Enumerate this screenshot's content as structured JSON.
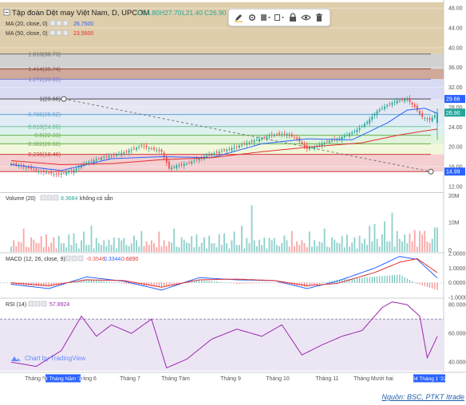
{
  "main_legend": {
    "title": "Tập đoàn Dệt may Việt Nam, D, UPCOM",
    "ohlc": [
      {
        "label": "O",
        "value": "24.80"
      },
      {
        "label": "H",
        "value": "27.70"
      },
      {
        "label": "L",
        "value": "21.40"
      },
      {
        "label": "C",
        "value": "26.90"
      }
    ],
    "ma20": {
      "label": "MA (20, close, 0)",
      "value": "26.7500",
      "color": "#2962ff"
    },
    "ma50": {
      "label": "MA (50, close, 0)",
      "value": "23.5600",
      "color": "#e03030"
    }
  },
  "fib_labels": [
    "1.618(38.73)",
    "1.414(35.74)",
    "1.272(33.65)",
    "1(29.66)",
    "0.786(26.52)",
    "0.618(24.06)",
    "0.5(22.33)",
    "0.382(20.60)",
    "0.236(18.46)"
  ],
  "price_axis": {
    "ticks": [
      "48.00",
      "44.00",
      "40.00",
      "36.00",
      "32.00",
      "28.00",
      "24.00",
      "20.00",
      "16.00",
      "12.00"
    ],
    "badges": [
      {
        "text": "29.66",
        "color": "#2962ff"
      },
      {
        "text": "26.90",
        "color": "#26a69a"
      },
      {
        "text": "14.99",
        "color": "#2962ff"
      }
    ]
  },
  "volume_legend": {
    "label": "Volume (20)",
    "value": "8.3684",
    "note": "không có sẵn"
  },
  "volume_axis": {
    "ticks": [
      "20M",
      "10M",
      "0"
    ]
  },
  "macd_legend": {
    "label": "MACD (12, 26, close, 9)",
    "values": [
      "-0.3546",
      "0.3344",
      "0.6890"
    ]
  },
  "macd_axis": {
    "ticks": [
      "2.0000",
      "1.0000",
      "0.0000",
      "-1.0000"
    ]
  },
  "rsi_legend": {
    "label": "RSI (14)",
    "value": "57.8924"
  },
  "rsi_axis": {
    "ticks": [
      "80.0000",
      "60.0000",
      "40.0000"
    ]
  },
  "time_axis": {
    "labels": [
      "Tháng 5",
      "Tháng 6",
      "Tháng 7",
      "Tháng Tám",
      "Tháng 9",
      "Tháng 10",
      "Tháng 11",
      "Tháng Mười hai"
    ],
    "start_badge": "18 Tháng Năm '21",
    "end_badge": "04 Tháng 1 '22"
  },
  "watermark": "Chart by TradingView",
  "source": "Nguồn: BSC, PTKT Itrade",
  "toolbar": [
    "pencil-icon",
    "gear-icon",
    "color-fill-icon",
    "rect-style-icon",
    "lock-icon",
    "eye-icon",
    "trash-icon"
  ],
  "chart_data": [
    {
      "type": "candlestick",
      "title": "Tập đoàn Dệt may Việt Nam, D, UPCOM",
      "ylim": [
        11,
        49
      ],
      "grid": true,
      "x_range": [
        "2021-05-18",
        "2022-01-04"
      ],
      "x_month_labels": [
        "Tháng 5",
        "Tháng 6",
        "Tháng 7",
        "Tháng Tám",
        "Tháng 9",
        "Tháng 10",
        "Tháng 11",
        "Tháng Mười hai"
      ],
      "close_path": [
        [
          0,
          16.6
        ],
        [
          6,
          15.8
        ],
        [
          12,
          15.0
        ],
        [
          18,
          14.4
        ],
        [
          24,
          15.0
        ],
        [
          30,
          16.8
        ],
        [
          36,
          17.8
        ],
        [
          42,
          18.4
        ],
        [
          48,
          19.4
        ],
        [
          52,
          20.2
        ],
        [
          56,
          19.6
        ],
        [
          60,
          19.0
        ],
        [
          63,
          15.6
        ],
        [
          66,
          16.2
        ],
        [
          70,
          16.6
        ],
        [
          75,
          17.6
        ],
        [
          80,
          18.6
        ],
        [
          86,
          19.4
        ],
        [
          92,
          20.4
        ],
        [
          98,
          21.4
        ],
        [
          104,
          22.4
        ],
        [
          110,
          22.6
        ],
        [
          114,
          21.6
        ],
        [
          118,
          19.6
        ],
        [
          122,
          20.2
        ],
        [
          126,
          21.0
        ],
        [
          130,
          21.6
        ],
        [
          134,
          22.4
        ],
        [
          138,
          23.4
        ],
        [
          142,
          25.0
        ],
        [
          146,
          27.2
        ],
        [
          150,
          28.4
        ],
        [
          154,
          29.3
        ],
        [
          158,
          29.6
        ],
        [
          161,
          28.0
        ],
        [
          164,
          26.0
        ],
        [
          167,
          25.4
        ],
        [
          170,
          26.9
        ]
      ],
      "series": [
        {
          "name": "MA (20, close, 0)",
          "color": "#2962ff",
          "points": [
            [
              0,
              16.4
            ],
            [
              20,
              15.2
            ],
            [
              40,
              17.6
            ],
            [
              60,
              18.0
            ],
            [
              80,
              17.8
            ],
            [
              100,
              20.6
            ],
            [
              118,
              21.6
            ],
            [
              136,
              21.4
            ],
            [
              150,
              24.8
            ],
            [
              158,
              27.4
            ],
            [
              165,
              27.8
            ],
            [
              170,
              26.75
            ]
          ]
        },
        {
          "name": "MA (50, close, 0)",
          "color": "#e03030",
          "points": [
            [
              0,
              17.2
            ],
            [
              20,
              16.4
            ],
            [
              40,
              16.6
            ],
            [
              60,
              17.4
            ],
            [
              80,
              17.8
            ],
            [
              100,
              19.0
            ],
            [
              120,
              20.0
            ],
            [
              140,
              20.8
            ],
            [
              155,
              22.4
            ],
            [
              165,
              23.2
            ],
            [
              170,
              23.56
            ]
          ]
        }
      ],
      "fibonacci_levels": [
        {
          "ratio": 1.618,
          "price": 38.73
        },
        {
          "ratio": 1.414,
          "price": 35.74
        },
        {
          "ratio": 1.272,
          "price": 33.65
        },
        {
          "ratio": 1,
          "price": 29.66
        },
        {
          "ratio": 0.786,
          "price": 26.52
        },
        {
          "ratio": 0.618,
          "price": 24.06
        },
        {
          "ratio": 0.5,
          "price": 22.33
        },
        {
          "ratio": 0.382,
          "price": 20.6
        },
        {
          "ratio": 0.236,
          "price": 18.46
        }
      ],
      "trendline": {
        "from_price": 29.66,
        "to_price": 14.99
      },
      "last": {
        "O": 24.8,
        "H": 27.7,
        "L": 21.4,
        "C": 26.9
      }
    },
    {
      "type": "bar",
      "name": "Volume (20)",
      "ylim": [
        0,
        20
      ],
      "unit": "M",
      "value": 8.3684
    },
    {
      "type": "line",
      "name": "MACD (12, 26, close, 9)",
      "ylim": [
        -1,
        2
      ],
      "values": {
        "histogram": -0.3546,
        "macd": 0.3344,
        "signal": 0.689
      },
      "macd_path": [
        [
          0,
          -0.1
        ],
        [
          15,
          -0.4
        ],
        [
          30,
          0.4
        ],
        [
          45,
          0.1
        ],
        [
          60,
          -0.5
        ],
        [
          75,
          0.35
        ],
        [
          90,
          0.2
        ],
        [
          105,
          0.15
        ],
        [
          118,
          -0.4
        ],
        [
          130,
          0.1
        ],
        [
          145,
          1.0
        ],
        [
          155,
          1.8
        ],
        [
          162,
          1.6
        ],
        [
          170,
          0.33
        ]
      ],
      "signal_path": [
        [
          0,
          0.0
        ],
        [
          15,
          -0.2
        ],
        [
          30,
          0.2
        ],
        [
          45,
          0.15
        ],
        [
          60,
          -0.3
        ],
        [
          75,
          0.2
        ],
        [
          90,
          0.25
        ],
        [
          105,
          0.15
        ],
        [
          118,
          -0.2
        ],
        [
          130,
          -0.05
        ],
        [
          145,
          0.7
        ],
        [
          155,
          1.4
        ],
        [
          162,
          1.65
        ],
        [
          170,
          0.69
        ]
      ]
    },
    {
      "type": "line",
      "name": "RSI (14)",
      "ylim": [
        34,
        84
      ],
      "value": 57.8924,
      "bands": [
        30,
        70
      ],
      "path": [
        [
          0,
          40
        ],
        [
          10,
          37
        ],
        [
          20,
          48
        ],
        [
          28,
          72
        ],
        [
          34,
          58
        ],
        [
          40,
          66
        ],
        [
          48,
          60
        ],
        [
          56,
          70
        ],
        [
          62,
          36
        ],
        [
          70,
          42
        ],
        [
          80,
          56
        ],
        [
          90,
          63
        ],
        [
          100,
          58
        ],
        [
          108,
          66
        ],
        [
          116,
          45
        ],
        [
          124,
          52
        ],
        [
          132,
          58
        ],
        [
          140,
          62
        ],
        [
          148,
          78
        ],
        [
          152,
          82
        ],
        [
          158,
          80
        ],
        [
          163,
          72
        ],
        [
          166,
          43
        ],
        [
          170,
          57.9
        ]
      ]
    }
  ]
}
